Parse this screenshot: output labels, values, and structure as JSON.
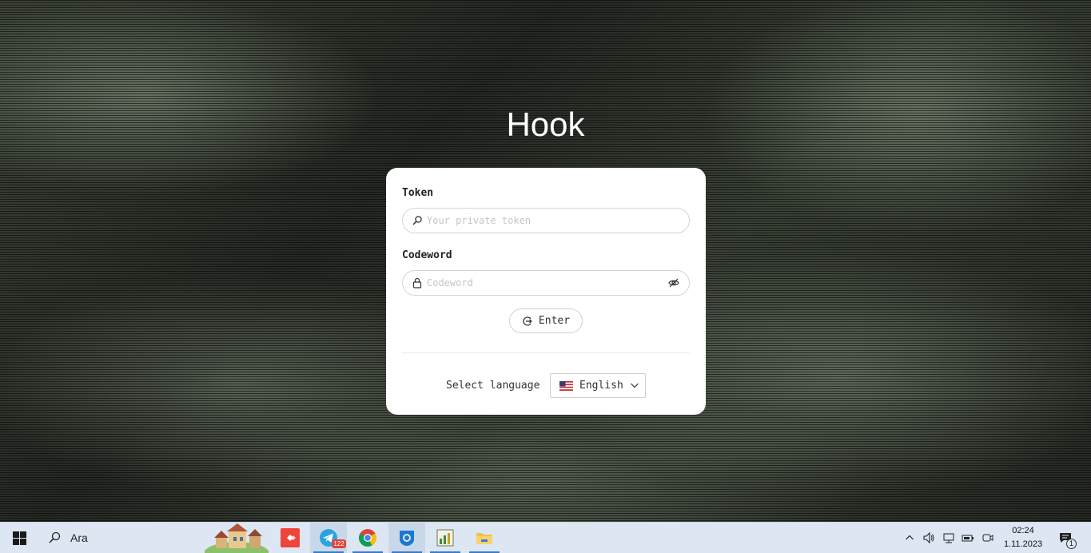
{
  "app": {
    "title": "Hook"
  },
  "form": {
    "token_label": "Token",
    "token_placeholder": "Your private token",
    "token_value": "",
    "codeword_label": "Codeword",
    "codeword_placeholder": "Codeword",
    "codeword_value": "",
    "enter_label": "Enter"
  },
  "language": {
    "label": "Select language",
    "selected": "English",
    "flag": "us-flag-icon"
  },
  "taskbar": {
    "search_label": "Ara",
    "apps": [
      {
        "name": "anydesk-app",
        "badge": ""
      },
      {
        "name": "telegram-app",
        "badge": "122"
      },
      {
        "name": "chrome-app",
        "badge": ""
      },
      {
        "name": "browser-app",
        "badge": ""
      },
      {
        "name": "chart-app",
        "badge": ""
      },
      {
        "name": "file-explorer-app",
        "badge": ""
      }
    ],
    "clock_time": "02:24",
    "clock_date": "1.11.2023",
    "notification_count": "1"
  },
  "colors": {
    "accent_blue": "#3a7cc9",
    "card_bg": "#ffffff",
    "anydesk_red": "#ef443b",
    "telegram_blue": "#2aa3e0"
  }
}
